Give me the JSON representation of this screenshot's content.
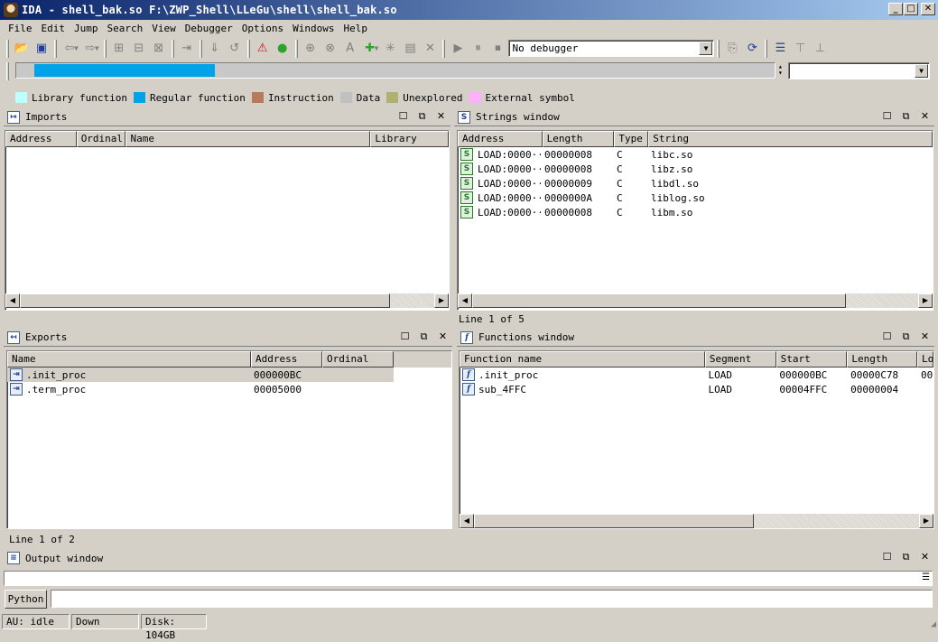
{
  "window": {
    "title": "IDA - shell_bak.so F:\\ZWP_Shell\\LLeGu\\shell\\shell_bak.so",
    "minimize": "_",
    "maximize": "□",
    "close": "✕"
  },
  "menu": [
    "File",
    "Edit",
    "Jump",
    "Search",
    "View",
    "Debugger",
    "Options",
    "Windows",
    "Help"
  ],
  "toolbar": {
    "debugger_select": "No debugger"
  },
  "legend": [
    {
      "label": "Library function",
      "color": "#c0ffff"
    },
    {
      "label": "Regular function",
      "color": "#00a2e8"
    },
    {
      "label": "Instruction",
      "color": "#b87a5a"
    },
    {
      "label": "Data",
      "color": "#c0c0c0"
    },
    {
      "label": "Unexplored",
      "color": "#b0b070"
    },
    {
      "label": "External symbol",
      "color": "#ffb0ff"
    }
  ],
  "imports": {
    "title": "Imports",
    "columns": [
      "Address",
      "Ordinal",
      "Name",
      "Library"
    ]
  },
  "strings": {
    "title": "Strings window",
    "columns": [
      "Address",
      "Length",
      "Type",
      "String"
    ],
    "rows": [
      {
        "address": "LOAD:0000···",
        "length": "00000008",
        "type": "C",
        "string": "libc.so"
      },
      {
        "address": "LOAD:0000···",
        "length": "00000008",
        "type": "C",
        "string": "libz.so"
      },
      {
        "address": "LOAD:0000···",
        "length": "00000009",
        "type": "C",
        "string": "libdl.so"
      },
      {
        "address": "LOAD:0000···",
        "length": "0000000A",
        "type": "C",
        "string": "liblog.so"
      },
      {
        "address": "LOAD:0000···",
        "length": "00000008",
        "type": "C",
        "string": "libm.so"
      }
    ],
    "status": "Line 1 of 5"
  },
  "exports": {
    "title": "Exports",
    "columns": [
      "Name",
      "Address",
      "Ordinal"
    ],
    "rows": [
      {
        "name": ".init_proc",
        "address": "000000BC",
        "ordinal": ""
      },
      {
        "name": ".term_proc",
        "address": "00005000",
        "ordinal": ""
      }
    ],
    "status": "Line 1 of 2"
  },
  "functions": {
    "title": "Functions window",
    "columns": [
      "Function name",
      "Segment",
      "Start",
      "Length",
      "Lo"
    ],
    "rows": [
      {
        "name": ".init_proc",
        "segment": "LOAD",
        "start": "000000BC",
        "length": "00000C78",
        "extra": "00"
      },
      {
        "name": "sub_4FFC",
        "segment": "LOAD",
        "start": "00004FFC",
        "length": "00000004",
        "extra": ""
      }
    ]
  },
  "output": {
    "title": "Output window",
    "python_button": "Python"
  },
  "statusbar": {
    "state": "AU:  idle",
    "direction": "Down",
    "disk": "Disk: 104GB"
  }
}
